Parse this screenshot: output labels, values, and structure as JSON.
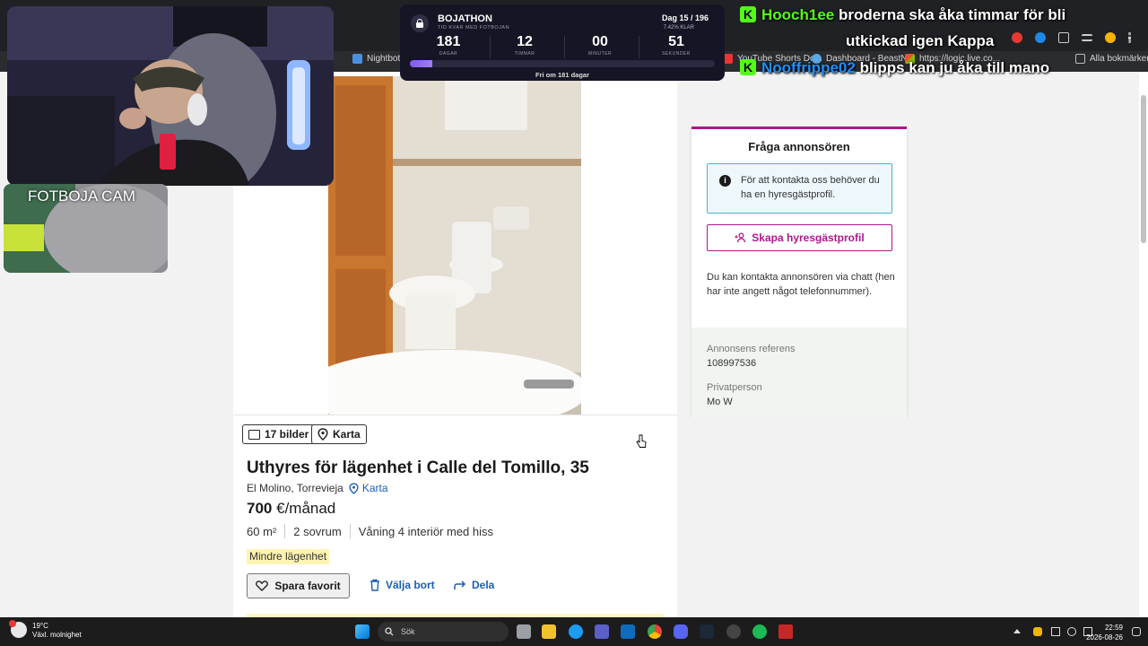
{
  "browser": {
    "bookmarks": [
      {
        "label": "Nightbot -",
        "color": "#4a90e2"
      },
      {
        "label": "YouTube Shorts Do...",
        "color": "#e33"
      },
      {
        "label": "Dashboard - BeastN...",
        "color": "#5aa9e6"
      },
      {
        "label": "https://logic.live.co...",
        "color": "#f35325"
      },
      {
        "label": "Alla bokmärken",
        "color": "#bbb"
      }
    ]
  },
  "listing": {
    "gallery_button": "17 bilder",
    "map_button": "Karta",
    "title": "Uthyres för lägenhet i Calle del Tomillo, 35",
    "location": "El Molino, Torrevieja",
    "map_link": "Karta",
    "price_amount": "700",
    "price_unit": "€/månad",
    "area": "60 m²",
    "rooms": "2 sovrum",
    "floor": "Våning 4 interiör med hiss",
    "tag": "Mindre lägenhet",
    "save_button": "Spara favorit",
    "hide_button": "Välja bort",
    "share_button": "Dela"
  },
  "contact": {
    "heading": "Fråga annonsören",
    "info_text": "För att kontakta oss behöver du ha en hyresgästprofil.",
    "profile_button": "Skapa hyresgästprofil",
    "chat_text": "Du kan kontakta annonsören via chatt (hen har inte angett något telefonnummer).",
    "ref_label": "Annonsens referens",
    "ref_value": "108997536",
    "owner_label": "Privatperson",
    "owner_value": "Mo W"
  },
  "overlay": {
    "cam_label": "FOTBOJA CAM",
    "timer": {
      "name": "BOJATHON",
      "subtitle": "TID KVAR MED FOTBOJAN",
      "day": "Dag 15 / 196",
      "percent": "7.42% KLAR",
      "progress": 0.0742,
      "units": [
        {
          "value": "181",
          "label": "DAGAR"
        },
        {
          "value": "12",
          "label": "TIMMAR"
        },
        {
          "value": "00",
          "label": "MINUTER"
        },
        {
          "value": "51",
          "label": "SEKUNDER"
        }
      ],
      "free_text": "Fri om 181 dagar"
    },
    "chat": [
      {
        "user": "Hooch1ee",
        "line1": "broderna ska åka timmar för bli",
        "line2": "utkickad igen Kappa",
        "user_color": "#53fc18"
      },
      {
        "user": "Nooffrippe02",
        "line1": "blipps kan ju åka till mano",
        "user_color": "#1e90ff"
      }
    ]
  },
  "taskbar": {
    "temperature": "19°C",
    "weather": "Växl. molnighet",
    "search_placeholder": "Sök",
    "time": "22:59",
    "date": "2026-08-26"
  }
}
